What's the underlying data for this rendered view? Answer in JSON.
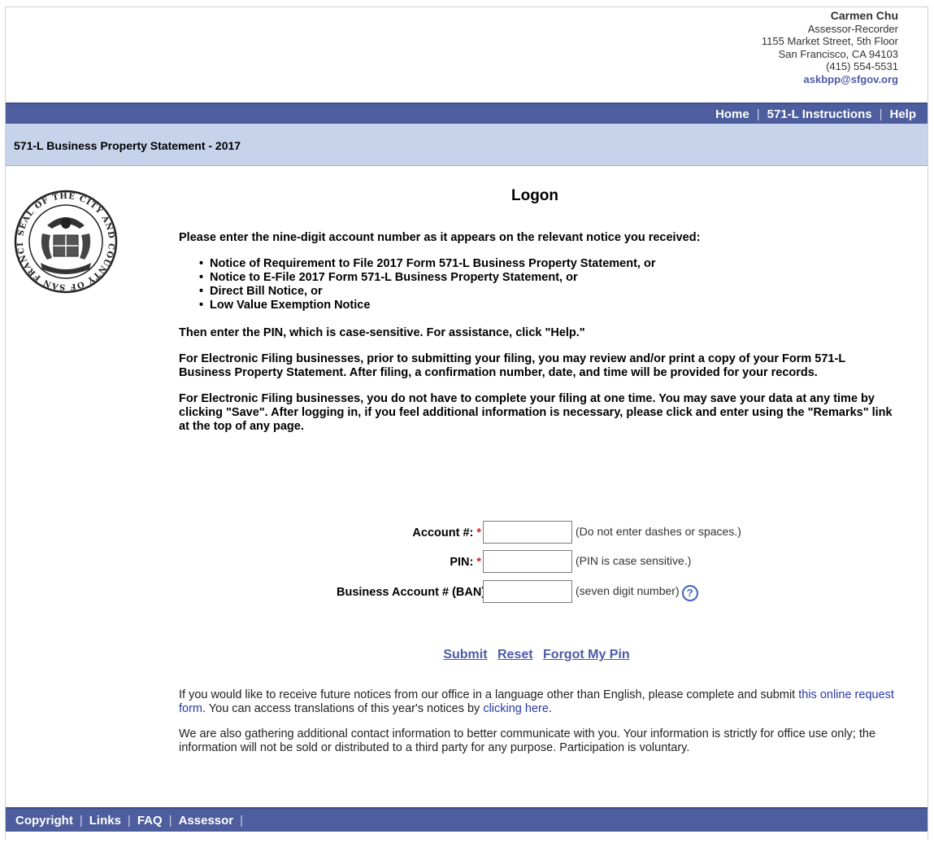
{
  "contact": {
    "name": "Carmen Chu",
    "title": "Assessor-Recorder",
    "address1": "1155 Market Street, 5th Floor",
    "address2": "San Francisco, CA 94103",
    "phone": "(415) 554-5531",
    "email": "askbpp@sfgov.org"
  },
  "topnav": {
    "home": "Home",
    "instructions": "571-L Instructions",
    "help": "Help",
    "sep": "|"
  },
  "page_title": "571-L Business Property Statement - 2017",
  "heading": "Logon",
  "intro": "Please enter the nine-digit account number as it appears on the relevant notice you received:",
  "notices": [
    "Notice of Requirement to File 2017 Form 571-L Business Property Statement, or",
    "Notice to E-File 2017 Form 571-L Business Property Statement, or",
    "Direct Bill Notice, or",
    "Low Value Exemption Notice"
  ],
  "para_pin": "Then enter the PIN, which is case-sensitive. For assistance, click \"Help.\"",
  "para_review": "For Electronic Filing businesses, prior to submitting your filing, you may review and/or print a copy of your Form 571-L Business Property Statement. After filing, a confirmation number, date, and time will be provided for your records.",
  "para_save": "For Electronic Filing businesses, you do not have to complete your filing at one time. You may save your data at any time by clicking \"Save\". After logging in, if you feel additional information is necessary, please click and enter using the \"Remarks\" link at the top of any page.",
  "form": {
    "account_label": "Account #:",
    "account_value": "",
    "account_hint": "(Do not enter dashes or spaces.)",
    "pin_label": "PIN:",
    "pin_value": "",
    "pin_hint": "(PIN is case sensitive.)",
    "ban_label": "Business Account # (BAN):",
    "ban_value": "",
    "ban_hint": "(seven digit number)",
    "required_mark": "*",
    "help_icon": "?"
  },
  "actions": {
    "submit": "Submit",
    "reset": "Reset",
    "forgot": "Forgot My Pin"
  },
  "notes": {
    "lang_pre": "If you would like to receive future notices from our office in a language other than English, please complete and submit ",
    "lang_link": "this online request form",
    "lang_mid": ". You can access translations of this year's notices by ",
    "lang_link2": "clicking here",
    "lang_end": ".",
    "contact_info": "We are also gathering additional contact information to better communicate with you. Your information is strictly for office use only; the information will not be sold or distributed to a third party for any purpose. Participation is voluntary."
  },
  "footnav": {
    "copyright": "Copyright",
    "links": "Links",
    "faq": "FAQ",
    "assessor": "Assessor",
    "sep": "|"
  },
  "seal_text": {
    "ring": "SEAL OF THE CITY AND COUNTY OF SAN FRANCISCO"
  },
  "colors": {
    "nav_bg": "#4d5d9e",
    "title_bg": "#c6d3ea",
    "link": "#4a5ba8",
    "required": "#d41f1f"
  }
}
